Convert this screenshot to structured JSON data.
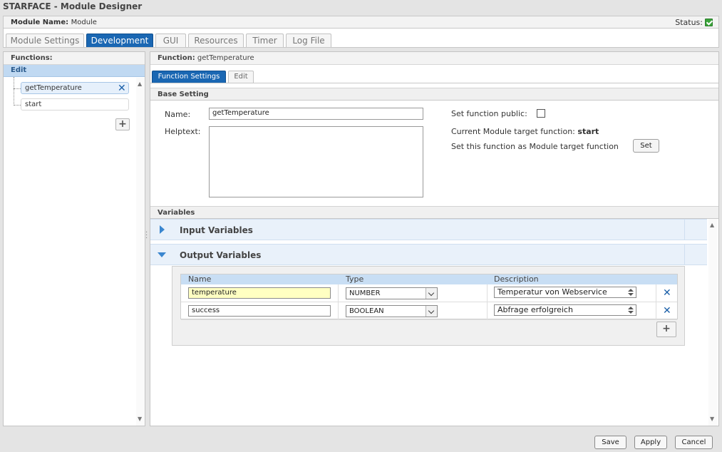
{
  "app": {
    "title": "STARFACE - Module Designer"
  },
  "module_bar": {
    "label": "Module Name:",
    "value": "Module",
    "status_label": "Status:"
  },
  "tabs": [
    {
      "label": "Module Settings",
      "active": false
    },
    {
      "label": "Development",
      "active": true
    },
    {
      "label": "GUI",
      "active": false
    },
    {
      "label": "Resources",
      "active": false
    },
    {
      "label": "Timer",
      "active": false
    },
    {
      "label": "Log File",
      "active": false
    }
  ],
  "functions_panel": {
    "header": "Functions:",
    "group": "Edit",
    "items": [
      {
        "label": "getTemperature",
        "selected": true
      },
      {
        "label": "start",
        "selected": false
      }
    ],
    "add_icon": "plus-icon"
  },
  "function_panel": {
    "header_label": "Function:",
    "header_value": "getTemperature",
    "subtabs": [
      {
        "label": "Function Settings",
        "active": true
      },
      {
        "label": "Edit",
        "active": false
      }
    ],
    "base_setting": {
      "title": "Base Setting",
      "name_label": "Name:",
      "name_value": "getTemperature",
      "helptext_label": "Helptext:",
      "helptext_value": "",
      "public_label": "Set function public:",
      "public_checked": false,
      "target_label": "Current Module target function:",
      "target_value": "start",
      "set_target_label": "Set this function as Module target function",
      "set_button": "Set"
    },
    "variables": {
      "title": "Variables",
      "input_title": "Input Variables",
      "input_expanded": false,
      "output_title": "Output Variables",
      "output_expanded": true,
      "columns": [
        "Name",
        "Type",
        "Description"
      ],
      "rows": [
        {
          "name": "temperature",
          "type": "NUMBER",
          "description": "Temperatur von Webservice",
          "highlight": true
        },
        {
          "name": "success",
          "type": "BOOLEAN",
          "description": "Abfrage erfolgreich",
          "highlight": false
        }
      ]
    }
  },
  "footer": {
    "save": "Save",
    "apply": "Apply",
    "cancel": "Cancel"
  },
  "colors": {
    "accent": "#1a67b3",
    "status_ok": "#3aa33a",
    "row_highlight": "#ffffc2"
  }
}
